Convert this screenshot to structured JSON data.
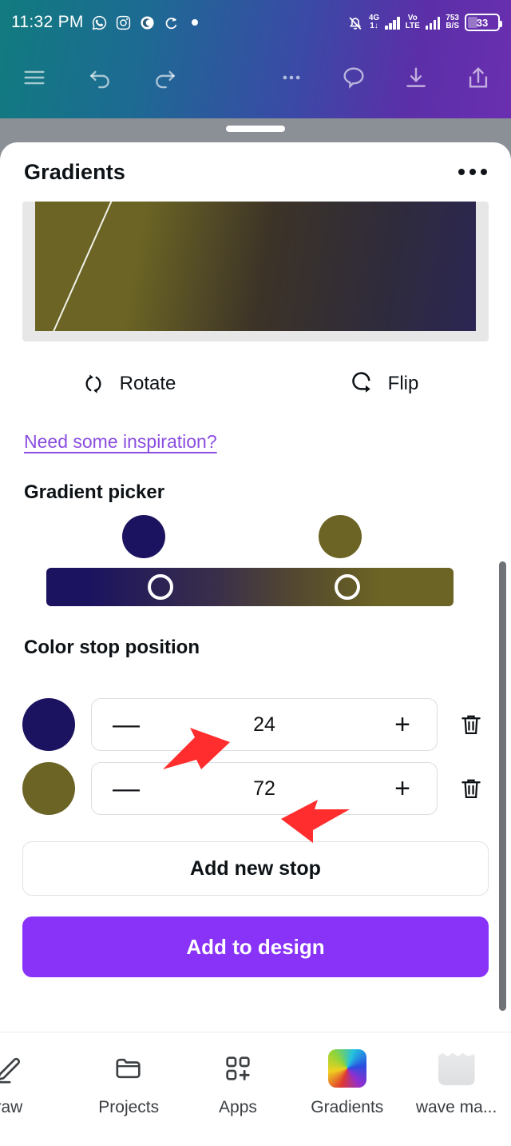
{
  "status_bar": {
    "time": "11:32 PM",
    "app_icons": [
      "whatsapp-icon",
      "instagram-icon",
      "app-c-icon",
      "sync-icon",
      "dot-icon"
    ],
    "notification_silent_icon": "bell-off-icon",
    "network_type": "4G",
    "network_sub": "1↓",
    "volte_top": "Vo",
    "volte_bottom": "LTE",
    "data_rate_value": "753",
    "data_rate_unit": "B/S",
    "battery_percent": "33"
  },
  "toolbar": {
    "left_icons": [
      "hamburger-menu-icon",
      "undo-icon",
      "redo-icon"
    ],
    "right_icons": [
      "more-options-icon",
      "comment-icon",
      "download-icon",
      "share-icon"
    ]
  },
  "sheet": {
    "title": "Gradients",
    "menu_icon": "kebab-menu-icon"
  },
  "preview": {
    "gradient_css": "linear-gradient(100deg, #6b6424 0%, #6b6424 24%, #3c3327 52%, #2f2b3b 78%, #2b2653 100%)",
    "direction_line": "gradient-direction-line"
  },
  "actions": {
    "rotate_label": "Rotate",
    "rotate_icon": "rotate-icon",
    "flip_label": "Flip",
    "flip_icon": "flip-icon"
  },
  "inspiration_link": "Need some inspiration?",
  "gradient_picker": {
    "heading": "Gradient picker",
    "bar_gradient": "linear-gradient(90deg, #1b1360 0%, #1b1360 10%, #3a2f4a 42%, #55492f 62%, #6b6424 82%, #6b6424 100%)",
    "stops": [
      {
        "color": "#1b1360",
        "position_pct": 24
      },
      {
        "color": "#6b6424",
        "position_pct": 72
      }
    ]
  },
  "color_stop_position": {
    "heading": "Color stop position",
    "decrement_label": "—",
    "increment_label": "+",
    "delete_icon": "trash-icon",
    "rows": [
      {
        "color": "#1b1360",
        "value": "24"
      },
      {
        "color": "#6b6424",
        "value": "72"
      }
    ]
  },
  "buttons": {
    "add_new_stop": "Add new stop",
    "add_to_design": "Add to design",
    "primary_color": "#8833f7"
  },
  "bottom_nav": {
    "items": [
      {
        "label": "raw",
        "icon": "draw-pen-icon",
        "active": false
      },
      {
        "label": "Projects",
        "icon": "folder-icon",
        "active": false
      },
      {
        "label": "Apps",
        "icon": "apps-grid-icon",
        "active": false
      },
      {
        "label": "Gradients",
        "icon": "gradients-rainbow-icon",
        "active": true
      },
      {
        "label": "wave ma...",
        "icon": "wave-thumbnail-icon",
        "active": false
      }
    ]
  },
  "annotations": {
    "cursor_color": "#ff2d2d",
    "cursors": [
      "cursor-arrow-stop-1",
      "cursor-arrow-stop-2"
    ]
  }
}
